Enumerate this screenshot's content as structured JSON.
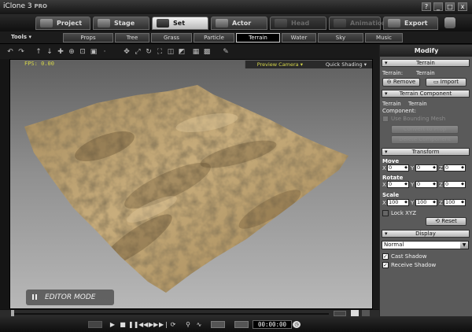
{
  "app": {
    "title": "iClone 3",
    "edition": "PRO"
  },
  "window_controls": [
    "?",
    "_",
    "□",
    "x"
  ],
  "main_tabs": [
    {
      "label": "Project",
      "icon": "project-icon",
      "state": "normal"
    },
    {
      "label": "Stage",
      "icon": "stage-icon",
      "state": "normal"
    },
    {
      "label": "Set",
      "icon": "set-icon",
      "state": "active"
    },
    {
      "label": "Actor",
      "icon": "actor-icon",
      "state": "normal"
    },
    {
      "label": "Head",
      "icon": "head-icon",
      "state": "disabled"
    },
    {
      "label": "Animation",
      "icon": "animation-icon",
      "state": "disabled"
    },
    {
      "label": "Export",
      "icon": "export-icon",
      "state": "normal"
    }
  ],
  "tools_label": "Tools ▾",
  "sub_tabs": [
    "Props",
    "Tree",
    "Grass",
    "Particle",
    "Terrain",
    "Water",
    "Sky",
    "Music"
  ],
  "active_sub_tab": "Terrain",
  "viewport": {
    "fps": "FPS: 0.00",
    "camera": "Preview Camera ▾",
    "shading": "Quick Shading ▾",
    "mode": "EDITOR MODE"
  },
  "panel": {
    "title": "Modify",
    "terrain_header": "Terrain",
    "terrain_label": "Terrain:",
    "terrain_value": "Terrain",
    "remove_label": "Remove",
    "import_label": "Import",
    "component_header": "Terrain Component",
    "component_label": "Terrain Component:",
    "component_value": "Terrain",
    "use_bounding_mesh": "Use Bounding Mesh",
    "convert_to_prop": "Convert to Prop",
    "delete_component": "Delete Component",
    "transform_header": "Transform",
    "move_label": "Move",
    "move": {
      "x": "0",
      "y": "0",
      "z": "0"
    },
    "rotate_label": "Rotate",
    "rotate": {
      "x": "0",
      "y": "0",
      "z": "0"
    },
    "scale_label": "Scale",
    "scale": {
      "x": "100",
      "y": "100",
      "z": "100"
    },
    "lock_xyz": "Lock XYZ",
    "reset_label": "Reset",
    "display_header": "Display",
    "display_mode": "Normal",
    "cast_shadow": "Cast Shadow",
    "receive_shadow": "Receive Shadow"
  },
  "playback": {
    "timecode": "00:00:00"
  },
  "colors": {
    "accent_yellow": "#d6d64a",
    "panel_bg": "#5a5a5a",
    "terrain": "#b89b6a"
  }
}
